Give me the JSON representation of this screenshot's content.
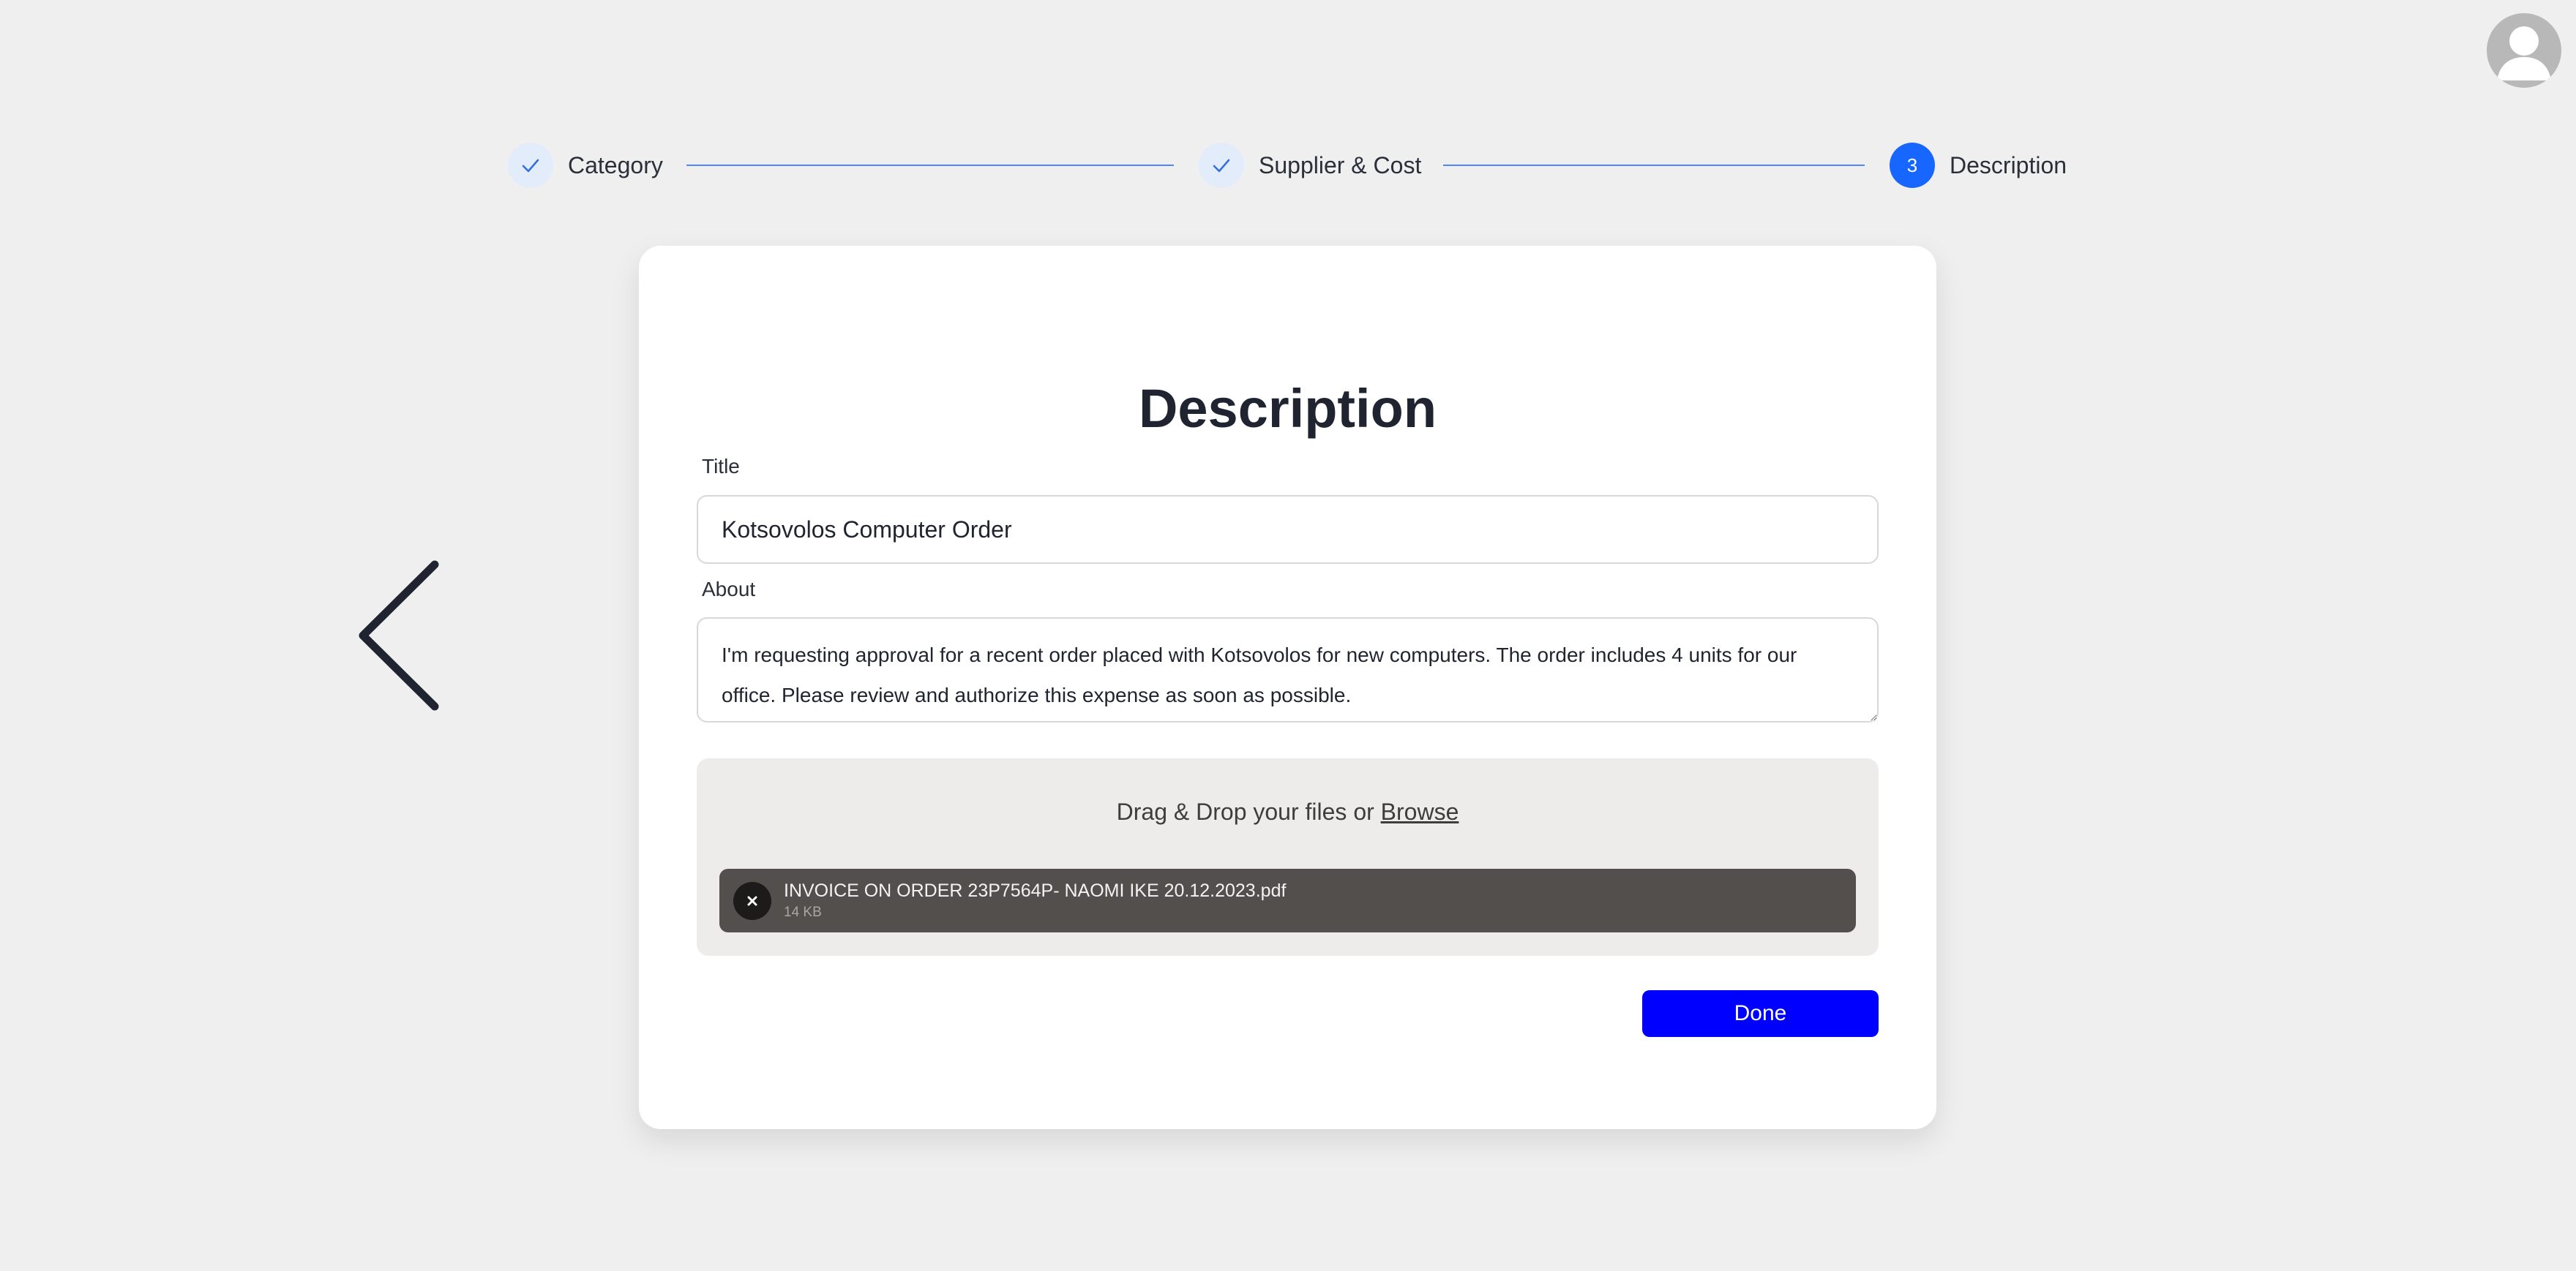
{
  "avatar": {
    "icon": "user-icon"
  },
  "stepper": {
    "steps": [
      {
        "label": "Category",
        "state": "done",
        "icon": "check-icon"
      },
      {
        "label": "Supplier & Cost",
        "state": "done",
        "icon": "check-icon"
      },
      {
        "label": "Description",
        "state": "active",
        "number": "3"
      }
    ],
    "accent_color": "#1766ff"
  },
  "navigation": {
    "back_icon": "chevron-left-icon"
  },
  "form": {
    "heading": "Description",
    "title_label": "Title",
    "title_value": "Kotsovolos Computer Order",
    "about_label": "About",
    "about_value": "I'm requesting approval for a recent order placed with Kotsovolos for new computers. The order includes 4 units for our office. Please review and authorize this expense as soon as possible.",
    "dropzone": {
      "text": "Drag & Drop your files or",
      "browse_label": "Browse"
    },
    "files": [
      {
        "name": "INVOICE ON ORDER 23P7564P- NAOMI IKE 20.12.2023.pdf",
        "size": "14 KB"
      }
    ],
    "done_label": "Done",
    "done_color": "#0000ff"
  }
}
